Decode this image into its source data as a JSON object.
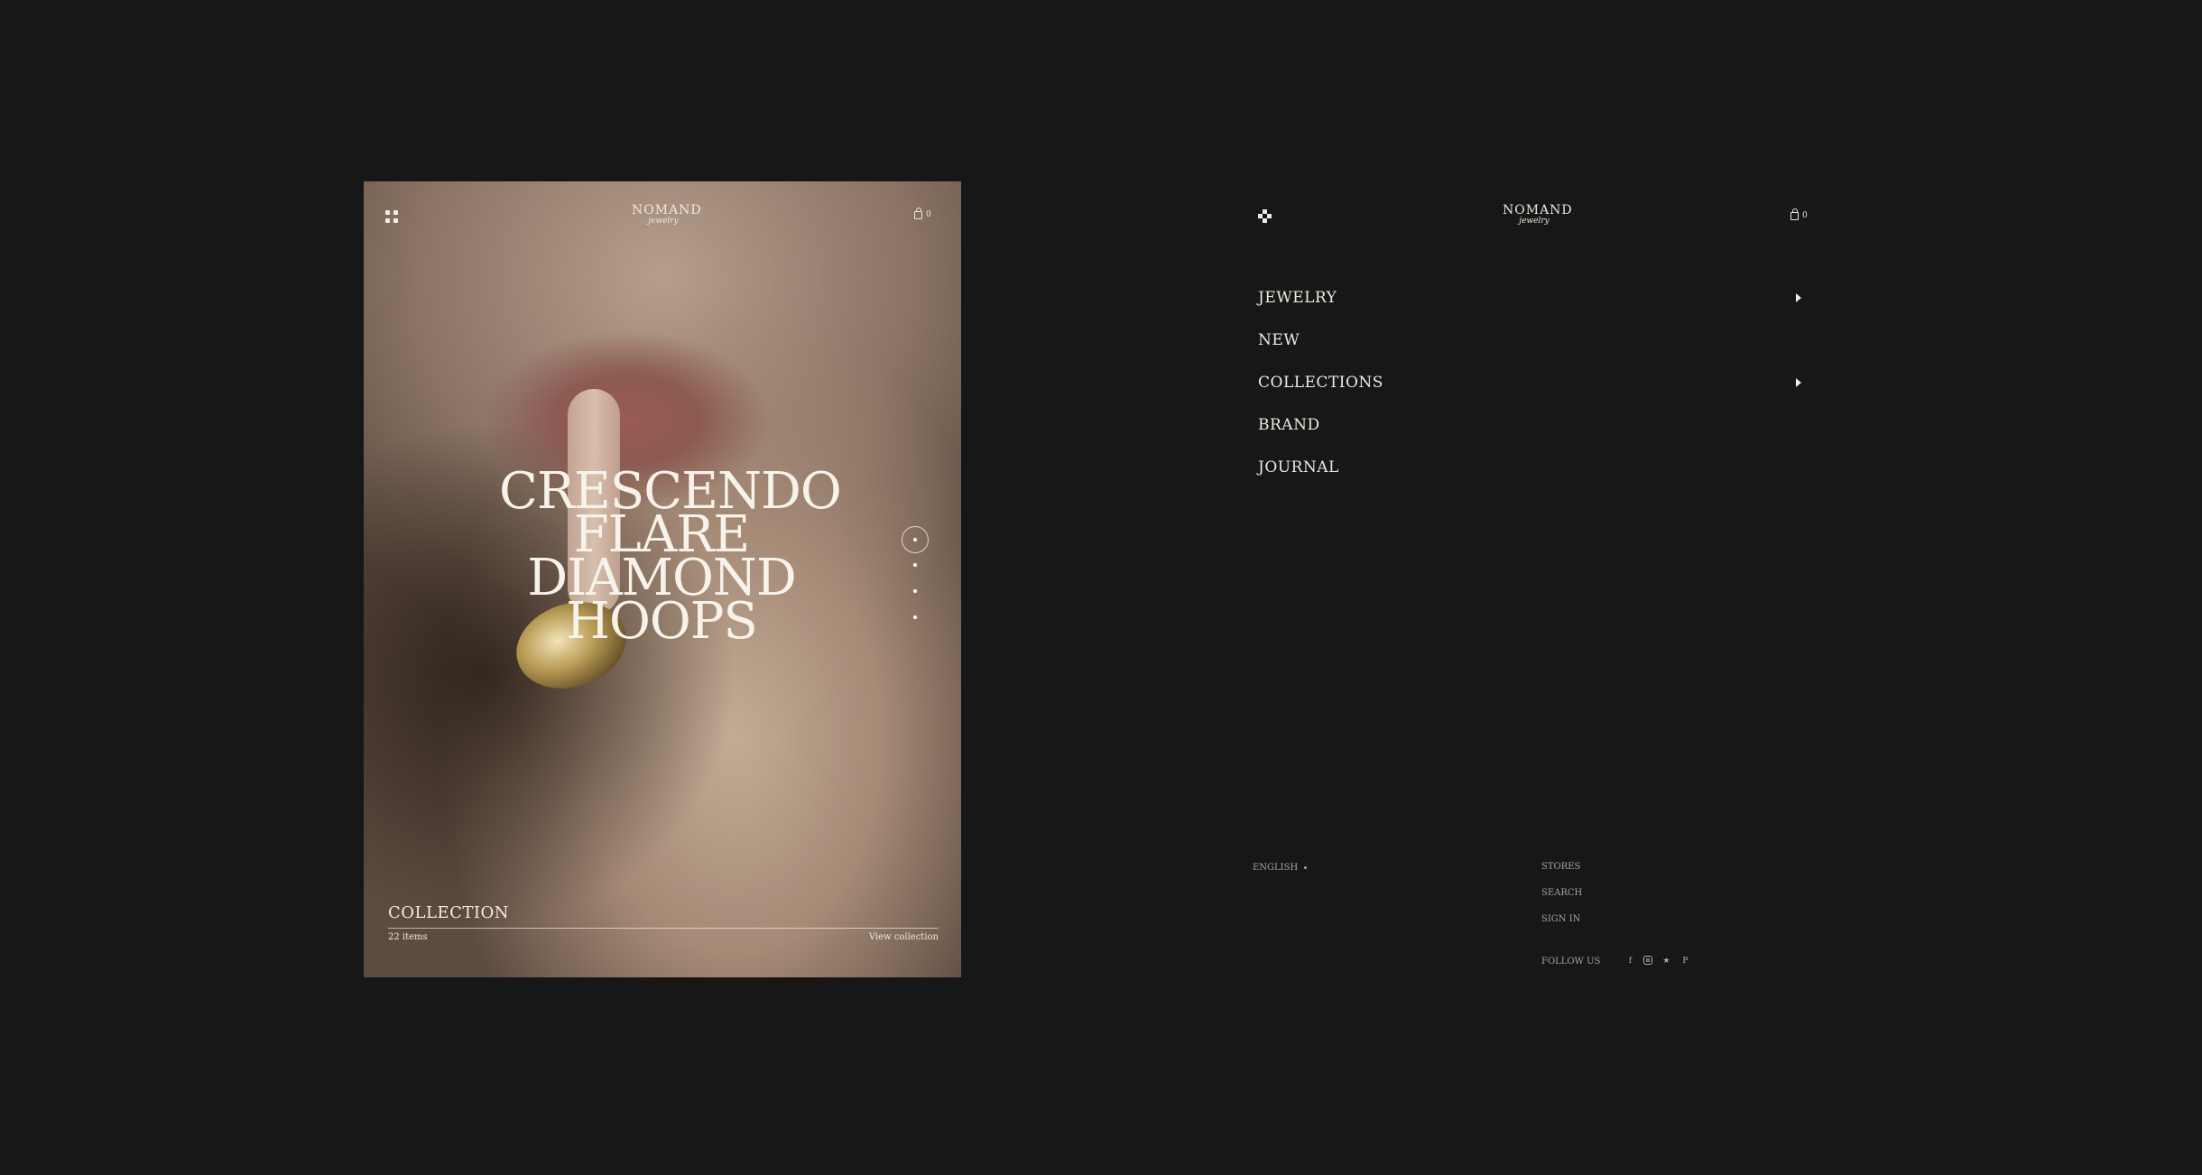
{
  "brand": {
    "name": "NOMAND",
    "tagline": "jewelry"
  },
  "hero": {
    "headline": [
      "CRESCENDO",
      "FLARE",
      "DIAMOND",
      "HOOPS"
    ],
    "cart_count": "0",
    "collection_label": "COLLECTION",
    "items_count": "22 items",
    "view_link": "View collection",
    "slides_total": 4,
    "slide_active": 1
  },
  "menu": {
    "cart_count": "0",
    "items": [
      {
        "label": "JEWELRY",
        "has_submenu": true
      },
      {
        "label": "NEW",
        "has_submenu": false
      },
      {
        "label": "COLLECTIONS",
        "has_submenu": true
      },
      {
        "label": "BRAND",
        "has_submenu": false
      },
      {
        "label": "JOURNAL",
        "has_submenu": false
      }
    ],
    "language": "ENGLISH",
    "links": [
      "STORES",
      "SEARCH",
      "SIGN IN"
    ],
    "follow_label": "FOLLOW US",
    "social_icons": [
      "facebook-icon",
      "instagram-icon",
      "twitter-icon",
      "pinterest-icon"
    ]
  },
  "colors": {
    "background": "#171717",
    "text": "#ece7df",
    "muted": "#a9a39b"
  }
}
